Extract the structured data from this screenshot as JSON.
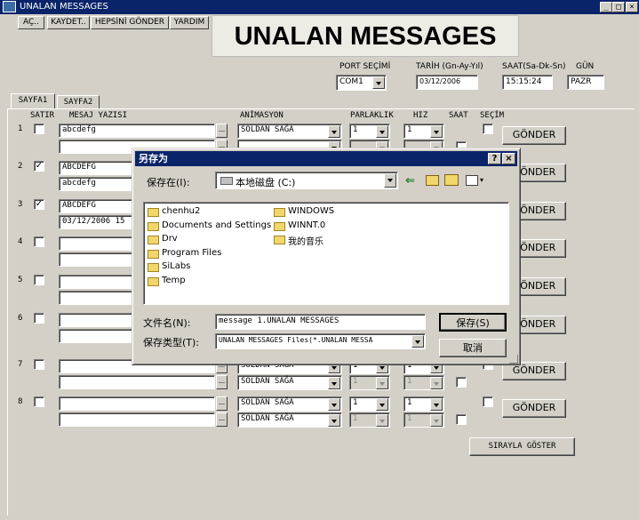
{
  "window": {
    "title": "UNALAN MESSAGES",
    "min": "_",
    "max": "□",
    "close": "×"
  },
  "toolbar": {
    "open": "AÇ..",
    "save": "KAYDET..",
    "send_all": "HEPSİNİ GÖNDER",
    "help": "YARDIM"
  },
  "banner": "UNALAN MESSAGES",
  "header": {
    "port_label": "PORT SEÇİMİ",
    "port_value": "COM1",
    "date_label": "TARİH (Gn-Ay-Yıl)",
    "date_value": "03/12/2006",
    "time_label": "SAAT(Sa-Dk-Sn)",
    "time_value": "15:15:24",
    "day_label": "GÜN",
    "day_value": "PAZR"
  },
  "tabs": [
    "SAYFA1",
    "SAYFA2"
  ],
  "columns": {
    "row": "SATIR",
    "message": "MESAJ YAZISI",
    "animation": "ANİMASYON",
    "brightness": "PARLAKLIK",
    "speed": "HIZ",
    "clock": "SAAT",
    "select": "SEÇİM"
  },
  "rows": [
    {
      "num": "1",
      "checked": "",
      "line1": "abcdefg",
      "line2": "",
      "anim1": "SOLDAN SAĞA",
      "anim2": "",
      "b1": "1",
      "b2": "",
      "s1": "1",
      "s2": "",
      "send": "GÖNDER"
    },
    {
      "num": "2",
      "checked": "✓",
      "line1": "ABCDEFG",
      "line2": "abcdefg",
      "anim1": "",
      "anim2": "",
      "b1": "",
      "b2": "",
      "s1": "",
      "s2": "",
      "send": "GÖNDER"
    },
    {
      "num": "3",
      "checked": "✓",
      "line1": "ABCDEFG",
      "line2": "03/12/2006  15",
      "anim1": "",
      "anim2": "",
      "b1": "",
      "b2": "",
      "s1": "",
      "s2": "",
      "send": "GÖNDER"
    },
    {
      "num": "4",
      "checked": "",
      "line1": "",
      "line2": "",
      "anim1": "",
      "anim2": "",
      "b1": "",
      "b2": "",
      "s1": "",
      "s2": "",
      "send": "GÖNDER"
    },
    {
      "num": "5",
      "checked": "",
      "line1": "",
      "line2": "",
      "anim1": "",
      "anim2": "",
      "b1": "",
      "b2": "",
      "s1": "",
      "s2": "",
      "send": "GÖNDER"
    },
    {
      "num": "6",
      "checked": "",
      "line1": "",
      "line2": "",
      "anim1": "",
      "anim2": "",
      "b1": "",
      "b2": "",
      "s1": "",
      "s2": "",
      "send": "GÖNDER"
    },
    {
      "num": "7",
      "checked": "",
      "line1": "",
      "line2": "",
      "anim1": "SOLDAN SAĞA",
      "anim2": "SOLDAN SAĞA",
      "b1": "1",
      "b2": "1",
      "s1": "1",
      "s2": "1",
      "send": "GÖNDER"
    },
    {
      "num": "8",
      "checked": "",
      "line1": "",
      "line2": "",
      "anim1": "SOLDAN SAĞA",
      "anim2": "SOLDAN SAĞA",
      "b1": "1",
      "b2": "1",
      "s1": "1",
      "s2": "1",
      "send": "GÖNDER"
    }
  ],
  "sequential_button": "SIRAYLA GÖSTER",
  "dialog": {
    "title": "另存为",
    "help": "?",
    "close": "×",
    "save_in_label": "保存在(I):",
    "save_in_value": "本地磁盘 (C:)",
    "folders_col1": [
      "chenhu2",
      "Documents and Settings",
      "Drv",
      "Program Files",
      "SiLabs",
      "Temp"
    ],
    "folders_col2": [
      "WINDOWS",
      "WINNT.0",
      "我的音乐"
    ],
    "filename_label": "文件名(N):",
    "filename_value": "message 1.UNALAN MESSAGES",
    "filetype_label": "保存类型(T):",
    "filetype_value": "UNALAN MESSAGES Files(*.UNALAN MESSA",
    "save_button": "保存(S)",
    "cancel_button": "取消"
  }
}
